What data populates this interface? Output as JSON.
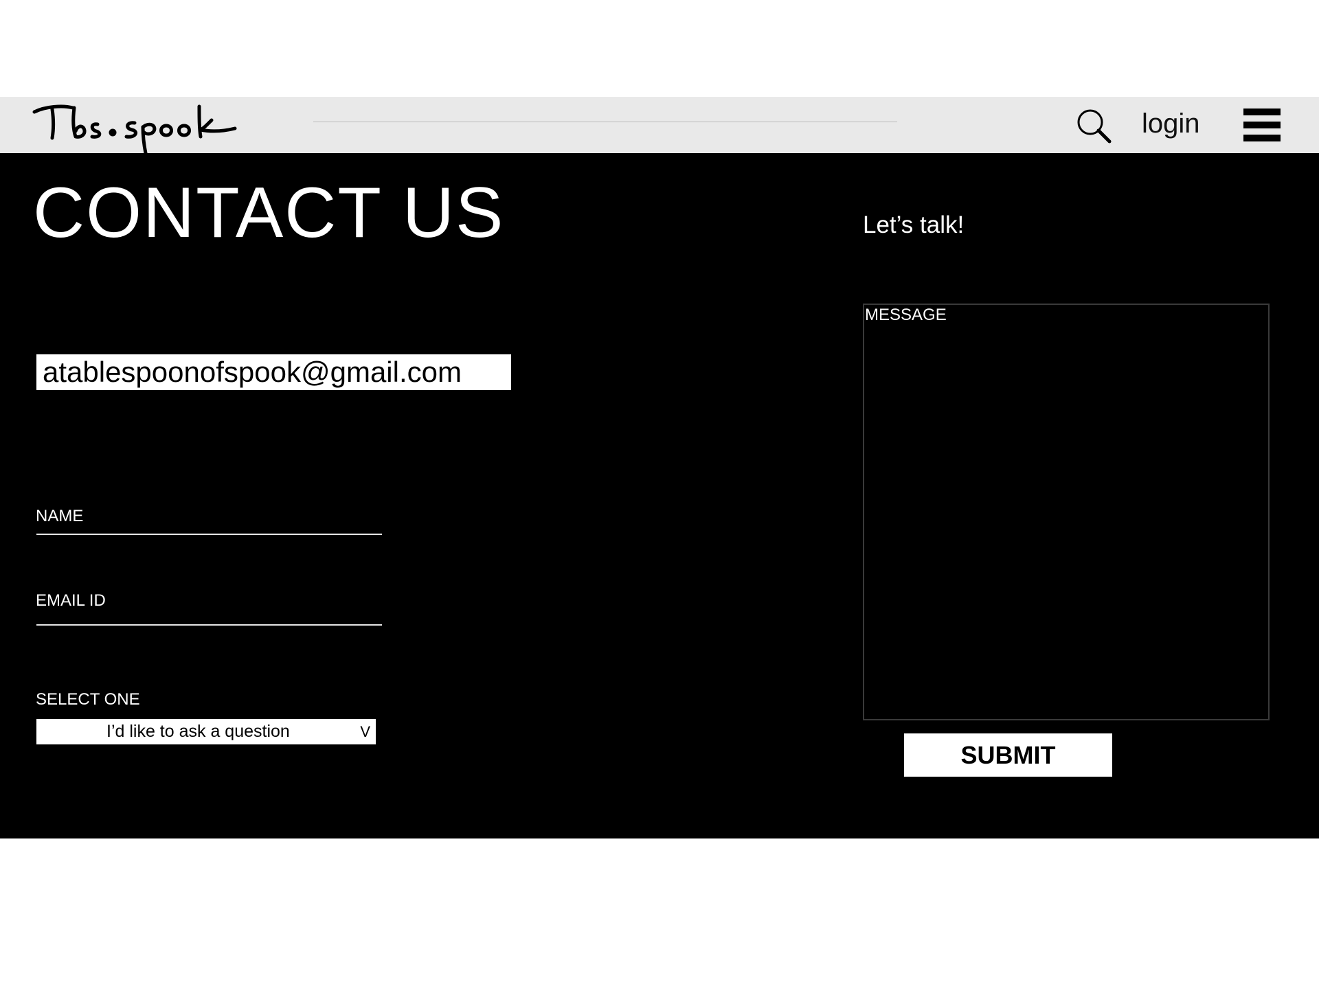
{
  "header": {
    "logo_text": "Tbs.spook",
    "search_icon": "search-icon",
    "login_label": "login",
    "menu_icon": "hamburger-menu-icon"
  },
  "main": {
    "title": "CONTACT US",
    "tagline": "Let’s talk!",
    "email_address": "atablespoonofspook@gmail.com"
  },
  "form": {
    "name_label": "NAME",
    "email_label": "EMAIL ID",
    "select_label": "SELECT ONE",
    "select_value": "I’d like to ask a question",
    "select_arrow": "V",
    "message_label": "MESSAGE",
    "submit_label": "SUBMIT"
  },
  "colors": {
    "header_bg": "#e9e9e9",
    "main_bg": "#000000",
    "text_light": "#ffffff"
  }
}
